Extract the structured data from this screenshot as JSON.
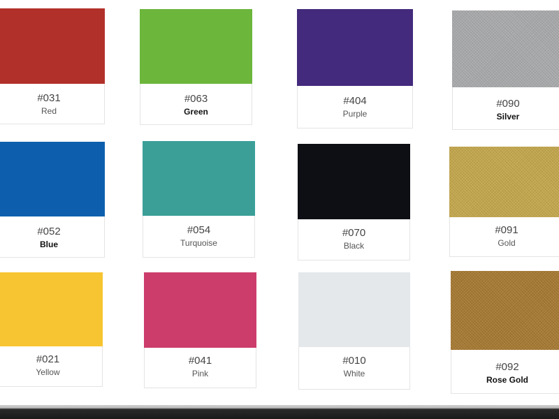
{
  "swatches": [
    {
      "code": "#031",
      "name": "Red",
      "color": "#b2302a",
      "bold": false
    },
    {
      "code": "#063",
      "name": "Green",
      "color": "#6cb63c",
      "bold": true
    },
    {
      "code": "#404",
      "name": "Purple",
      "color": "#432a7c",
      "bold": false
    },
    {
      "code": "#090",
      "name": "Silver",
      "color": "#a9aaab",
      "bold": true
    },
    {
      "code": "#052",
      "name": "Blue",
      "color": "#0d5fae",
      "bold": true
    },
    {
      "code": "#054",
      "name": "Turquoise",
      "color": "#3b9f98",
      "bold": false
    },
    {
      "code": "#070",
      "name": "Black",
      "color": "#0d0f14",
      "bold": false
    },
    {
      "code": "#091",
      "name": "Gold",
      "color": "#c4a64a",
      "bold": false
    },
    {
      "code": "#021",
      "name": "Yellow",
      "color": "#f6c531",
      "bold": false
    },
    {
      "code": "#041",
      "name": "Pink",
      "color": "#cc3d6c",
      "bold": false
    },
    {
      "code": "#010",
      "name": "White",
      "color": "#e4e8ea",
      "bold": false
    },
    {
      "code": "#092",
      "name": "Rose Gold",
      "color": "#a6782f",
      "bold": true
    }
  ]
}
